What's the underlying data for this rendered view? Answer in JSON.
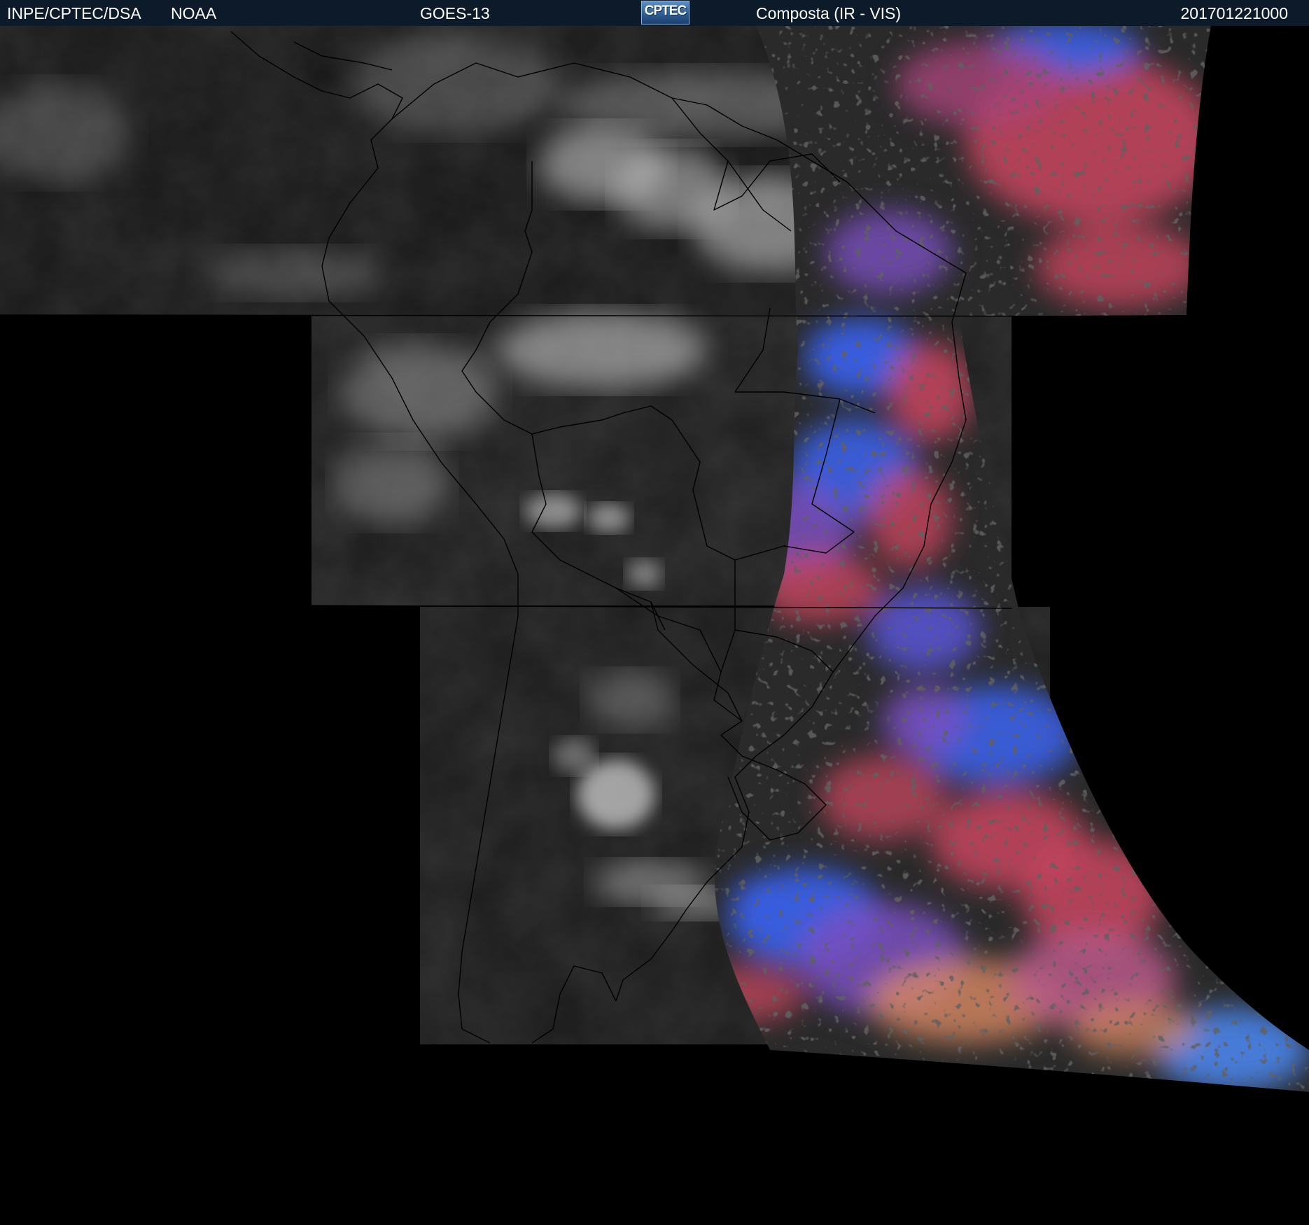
{
  "header": {
    "org": "INPE/CPTEC/DSA",
    "agency": "NOAA",
    "satellite": "GOES-13",
    "logo_text": "CPTEC",
    "product": "Composta (IR - VIS)",
    "timestamp": "201701221000"
  },
  "colors": {
    "header_bg": "#0d1a2a",
    "ir_gray_background": "#2f2f2f",
    "cloud_white": "#e8e8e8",
    "vis_blue": "#3a5fe6",
    "vis_violet": "#7a4fc0",
    "vis_red": "#c8465f",
    "vis_orange": "#d98a62",
    "background": "#000000",
    "border_lines": "#000000"
  }
}
